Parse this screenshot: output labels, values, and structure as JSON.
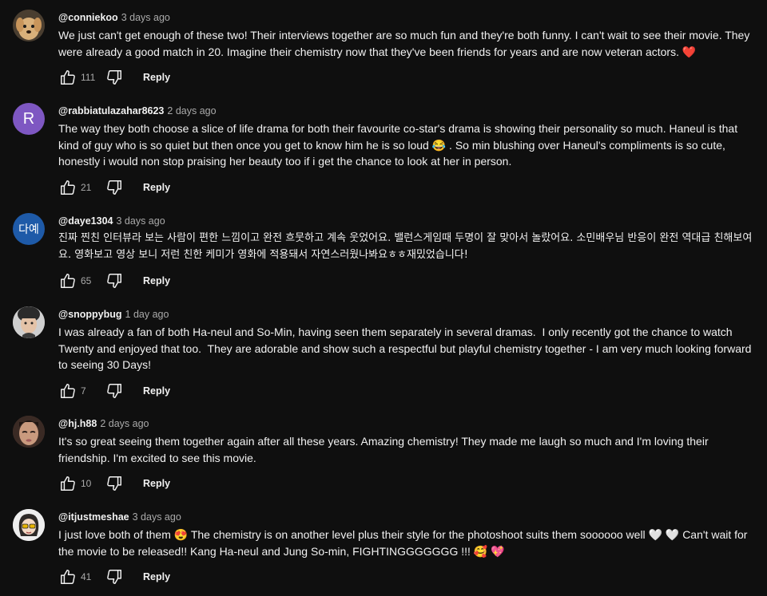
{
  "comments": [
    {
      "author": "@conniekoo",
      "time": "3 days ago",
      "text": "We just can't get enough of these two! Their interviews together are so much fun and they're both funny. I can't wait to see their movie. They were already a good match in 20. Imagine their chemistry now that they've been friends for years and are now veteran actors. ❤️",
      "likes": "111",
      "reply_label": "Reply",
      "avatar_icon": "dog-photo-icon"
    },
    {
      "author": "@rabbiatulazahar8623",
      "time": "2 days ago",
      "text": "The way they both choose a slice of life drama for both their favourite co-star's drama is showing their personality so much. Haneul is that kind of guy who is so quiet but then once you get to know him he is so loud 😂 . So min blushing over Haneul's compliments is so cute, honestly i would non stop praising her beauty too if i get the chance to look at her in person.",
      "likes": "21",
      "reply_label": "Reply",
      "avatar_letter": "R",
      "avatar_color": "#7e57c2"
    },
    {
      "author": "@daye1304",
      "time": "3 days ago",
      "text": "진짜 찐친 인터뷰라 보는 사람이 편한 느낌이고 완전 흐뭇하고 계속 웃었어요. 밸런스게임때 두명이 잘 맞아서 놀랐어요. 소민배우님 반응이 완전 역대급 친해보여요. 영화보고 영상 보니 저런 친한 케미가 영화에 적용돼서 자연스러웠나봐요ㅎㅎ재밌었습니다!",
      "likes": "65",
      "reply_label": "Reply",
      "avatar_letter": "다예",
      "avatar_color": "#1e5aa8"
    },
    {
      "author": "@snoppybug",
      "time": "1 day ago",
      "text": "I was already a fan of both Ha-neul and So-Min, having seen them separately in several dramas.  I only recently got the chance to watch Twenty and enjoyed that too.  They are adorable and show such a respectful but playful chemistry together - I am very much looking forward to seeing 30 Days!",
      "likes": "7",
      "reply_label": "Reply",
      "avatar_icon": "person-photo-icon"
    },
    {
      "author": "@hj.h88",
      "time": "2 days ago",
      "text": "It's so great seeing them together again after all these years. Amazing chemistry! They made me laugh so much and I'm loving their friendship. I'm excited to see this movie.",
      "likes": "10",
      "reply_label": "Reply",
      "avatar_icon": "woman-photo-icon"
    },
    {
      "author": "@itjustmeshae",
      "time": "3 days ago",
      "text": "I just love both of them 😍 The chemistry is on another level plus their style for the photoshoot suits them soooooo well 🤍 🤍 Can't wait for the movie to be released!! Kang Ha-neul and Jung So-min, FIGHTINGGGGGGG !!! 🥰 💖",
      "likes": "41",
      "reply_label": "Reply",
      "avatar_icon": "cartoon-girl-icon"
    }
  ],
  "icons": {
    "like": "thumbs-up-icon",
    "dislike": "thumbs-down-icon"
  },
  "colors": {
    "background": "#0f0f0f",
    "text_primary": "#f1f1f1",
    "text_secondary": "#aaaaaa"
  }
}
